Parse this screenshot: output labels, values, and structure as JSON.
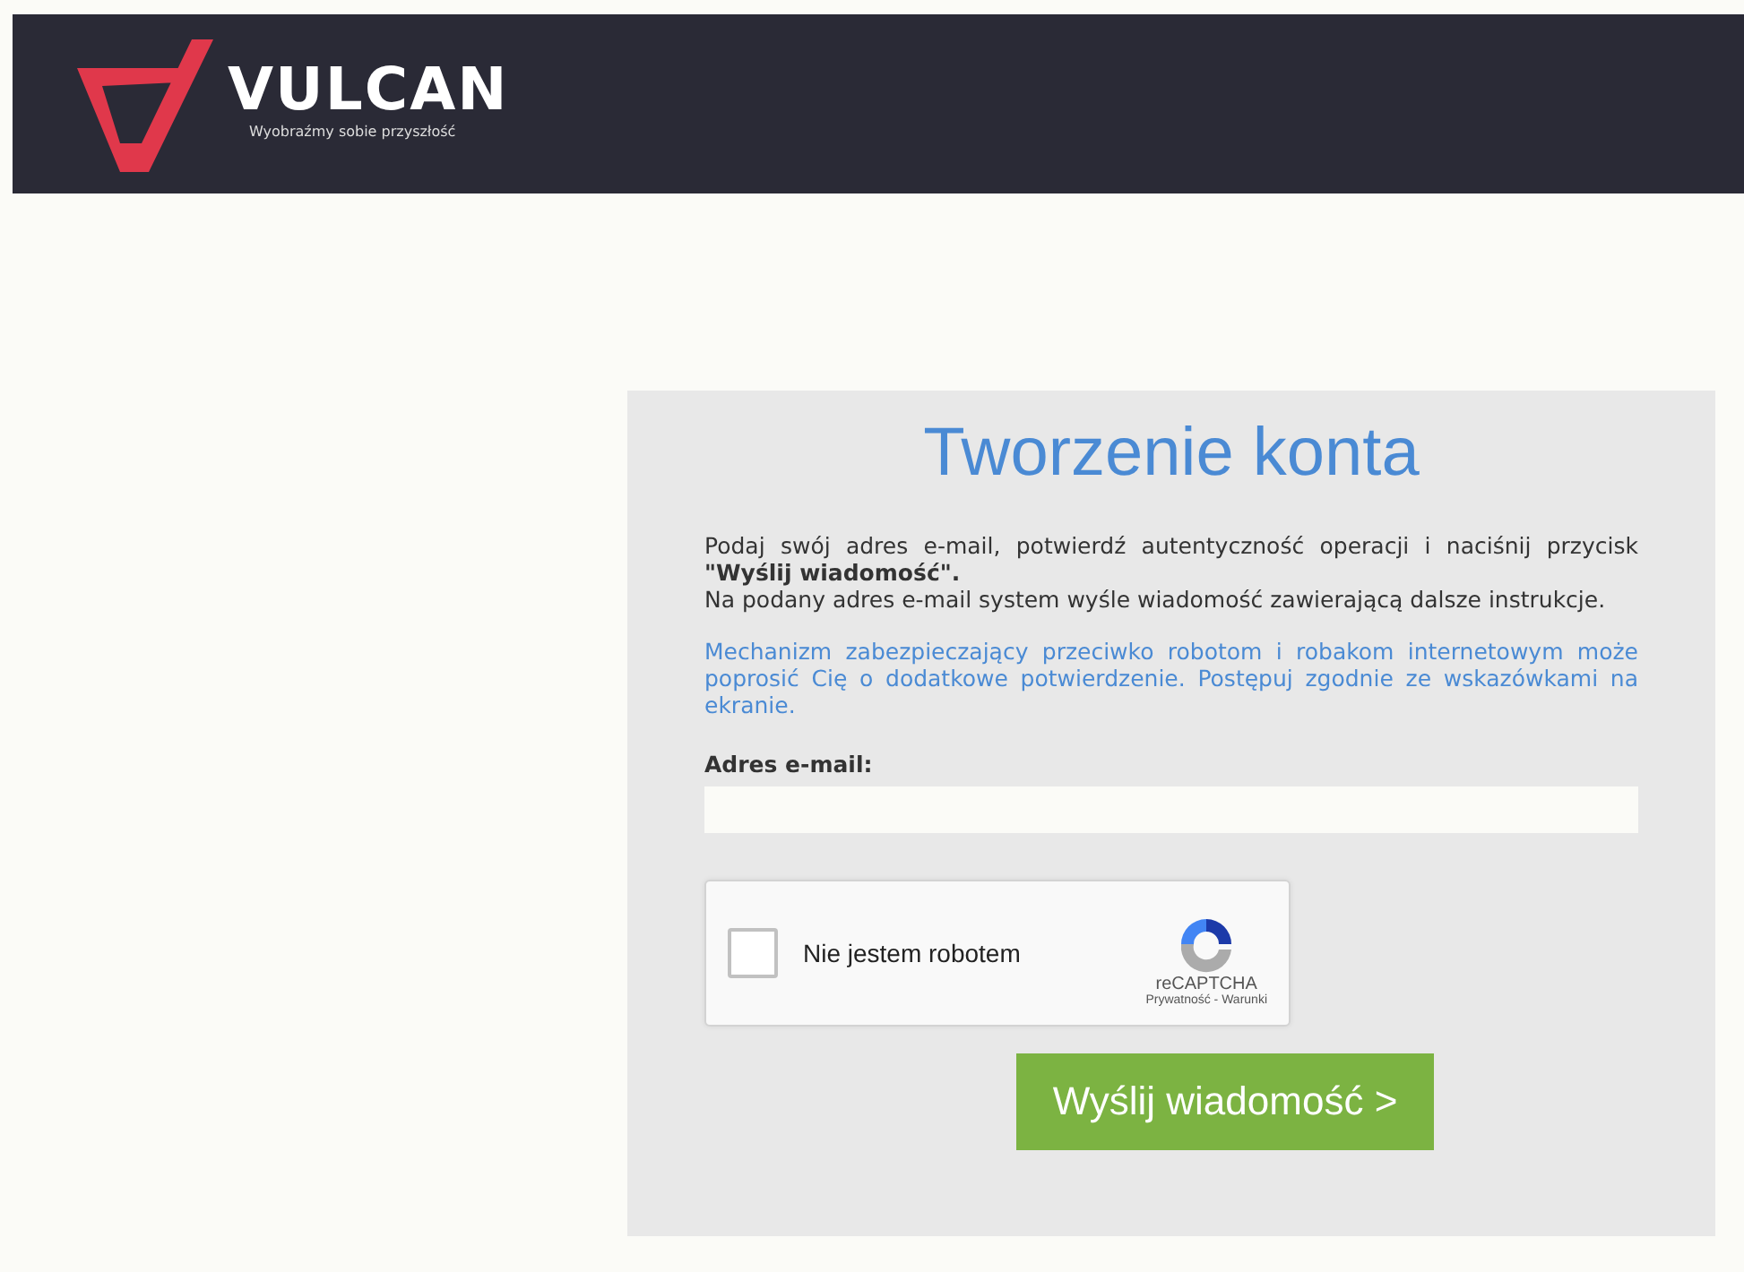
{
  "header": {
    "brand": "VULCAN",
    "tagline": "Wyobraźmy sobie przyszłość"
  },
  "form": {
    "title": "Tworzenie konta",
    "instructions": [
      "Podaj swój adres e-mail, potwierdź autentyczność operacji i naciśnij przycisk **\"Wyślij wiadomość\".**",
      "Na podany adres e-mail system wyśle wiadomość zawierającą dalsze instrukcje."
    ],
    "notice": "Mechanizm zabezpieczający przeciwko robotom i robakom internetowym może poprosić Cię o dodatkowe potwierdzenie. Postępuj zgodnie ze wskazówkami na ekranie.",
    "email": {
      "label": "Adres e-mail:"
    },
    "captcha": {
      "label": "Nie jestem robotem",
      "checked": false,
      "brand": "reCAPTCHA",
      "links": "Prywatność - Warunki"
    },
    "submit": "Wyślij wiadomość >"
  }
}
